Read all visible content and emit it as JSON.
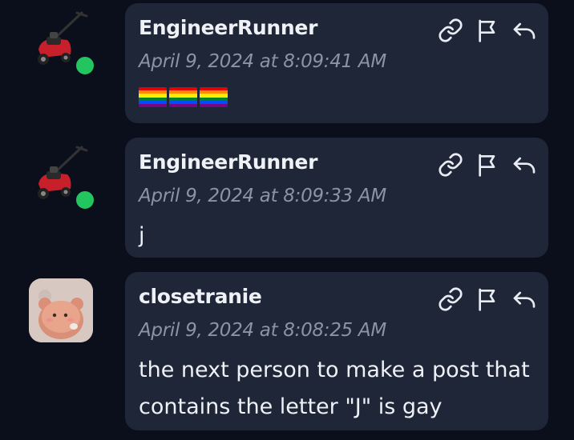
{
  "posts": [
    {
      "username": "EngineerRunner",
      "timestamp": "April 9, 2024 at 8:09:41 AM",
      "content": "",
      "emoji": [
        "rainbow-flag",
        "rainbow-flag",
        "rainbow-flag"
      ],
      "status": "online",
      "avatar": "lawn-mower"
    },
    {
      "username": "EngineerRunner",
      "timestamp": "April 9, 2024 at 8:09:33 AM",
      "content": "j",
      "status": "online",
      "avatar": "lawn-mower"
    },
    {
      "username": "closetranie",
      "timestamp": "April 9, 2024 at 8:08:25 AM",
      "content": "the next person to make a post that contains the letter \"J\" is gay",
      "avatar": "bear-sticker"
    }
  ],
  "actions": [
    "link-icon",
    "flag-icon",
    "reply-icon"
  ],
  "colors": {
    "background": "#0b0f1c",
    "bubble": "#1f2637",
    "online": "#22c55e",
    "username": "#eef1f6",
    "timestamp": "#8b93a4"
  }
}
